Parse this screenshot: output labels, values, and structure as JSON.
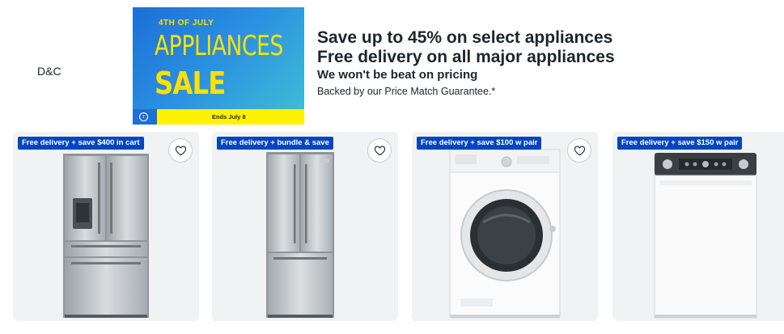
{
  "logo": {
    "text": "D&C"
  },
  "banner": {
    "top_line": "4TH OF JULY",
    "title_line1": "APPLIANCES",
    "title_line2": "SALE",
    "ends": "Ends July 8",
    "info_icon": "info-icon",
    "colors": {
      "blue": "#1b6fd6",
      "yellow": "#ffe000"
    }
  },
  "promo": {
    "headline1": "Save up to 45% on select appliances",
    "headline2": "Free delivery on all major appliances",
    "subheadline": "We won't be beat on pricing",
    "note": "Backed by our Price Match Guarantee.*"
  },
  "products": [
    {
      "badge": "Free delivery + save $400 in cart",
      "image": "french-door-refrigerator-image",
      "saved": false
    },
    {
      "badge": "Free delivery + bundle & save",
      "image": "french-door-refrigerator-image",
      "saved": false
    },
    {
      "badge": "Free delivery + save $100 w pair",
      "image": "front-load-washer-image",
      "saved": false
    },
    {
      "badge": "Free delivery + save $150 w pair",
      "image": "top-load-washer-image"
    }
  ],
  "colors": {
    "badge_bg": "#0046be",
    "card_bg": "#f0f2f4",
    "text": "#1d252c"
  }
}
